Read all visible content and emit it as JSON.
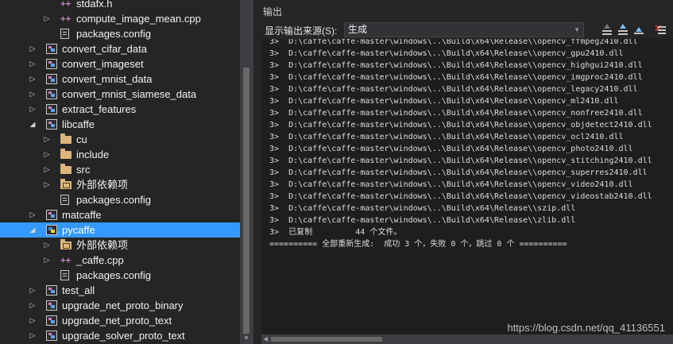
{
  "solution_explorer": {
    "items": [
      {
        "label": "stdafx.h",
        "icon": "header-file-icon",
        "arrow": "",
        "selected": false
      },
      {
        "label": "compute_image_mean.cpp",
        "icon": "cpp-file-icon",
        "arrow": "collapsed",
        "selected": false
      },
      {
        "label": "packages.config",
        "icon": "config-file-icon",
        "arrow": "",
        "selected": false
      },
      {
        "label": "convert_cifar_data",
        "icon": "project-icon",
        "arrow": "collapsed",
        "selected": false
      },
      {
        "label": "convert_imageset",
        "icon": "project-icon",
        "arrow": "collapsed",
        "selected": false
      },
      {
        "label": "convert_mnist_data",
        "icon": "project-icon",
        "arrow": "collapsed",
        "selected": false
      },
      {
        "label": "convert_mnist_siamese_data",
        "icon": "project-icon",
        "arrow": "collapsed",
        "selected": false
      },
      {
        "label": "extract_features",
        "icon": "project-icon",
        "arrow": "collapsed",
        "selected": false
      },
      {
        "label": "libcaffe",
        "icon": "project-icon",
        "arrow": "expanded",
        "selected": false
      },
      {
        "label": "cu",
        "icon": "folder-icon",
        "arrow": "collapsed",
        "selected": false
      },
      {
        "label": "include",
        "icon": "folder-icon",
        "arrow": "collapsed",
        "selected": false
      },
      {
        "label": "src",
        "icon": "folder-icon",
        "arrow": "collapsed",
        "selected": false
      },
      {
        "label": "外部依赖项",
        "icon": "external-deps-icon",
        "arrow": "collapsed",
        "selected": false
      },
      {
        "label": "packages.config",
        "icon": "config-file-icon",
        "arrow": "",
        "selected": false
      },
      {
        "label": "matcaffe",
        "icon": "project-icon",
        "arrow": "collapsed",
        "selected": false
      },
      {
        "label": "pycaffe",
        "icon": "python-project-icon",
        "arrow": "expanded",
        "selected": true
      },
      {
        "label": "外部依赖项",
        "icon": "external-deps-icon",
        "arrow": "collapsed",
        "selected": false
      },
      {
        "label": "_caffe.cpp",
        "icon": "cpp-file-icon",
        "arrow": "collapsed",
        "selected": false
      },
      {
        "label": "packages.config",
        "icon": "config-file-icon",
        "arrow": "",
        "selected": false
      },
      {
        "label": "test_all",
        "icon": "project-icon",
        "arrow": "collapsed",
        "selected": false
      },
      {
        "label": "upgrade_net_proto_binary",
        "icon": "project-icon",
        "arrow": "collapsed",
        "selected": false
      },
      {
        "label": "upgrade_net_proto_text",
        "icon": "project-icon",
        "arrow": "collapsed",
        "selected": false
      },
      {
        "label": "upgrade_solver_proto_text",
        "icon": "project-icon",
        "arrow": "collapsed",
        "selected": false
      }
    ]
  },
  "output": {
    "title": "输出",
    "source_label": "显示输出来源(S):",
    "source_value": "生成",
    "lines": [
      "3>  D:\\caffe\\caffe-master\\windows\\..\\Build\\x64\\Release\\\\opencv_ffmpeg2410.dll",
      "3>  D:\\caffe\\caffe-master\\windows\\..\\Build\\x64\\Release\\\\opencv_gpu2410.dll",
      "3>  D:\\caffe\\caffe-master\\windows\\..\\Build\\x64\\Release\\\\opencv_highgui2410.dll",
      "3>  D:\\caffe\\caffe-master\\windows\\..\\Build\\x64\\Release\\\\opencv_imgproc2410.dll",
      "3>  D:\\caffe\\caffe-master\\windows\\..\\Build\\x64\\Release\\\\opencv_legacy2410.dll",
      "3>  D:\\caffe\\caffe-master\\windows\\..\\Build\\x64\\Release\\\\opencv_ml2410.dll",
      "3>  D:\\caffe\\caffe-master\\windows\\..\\Build\\x64\\Release\\\\opencv_nonfree2410.dll",
      "3>  D:\\caffe\\caffe-master\\windows\\..\\Build\\x64\\Release\\\\opencv_objdetect2410.dll",
      "3>  D:\\caffe\\caffe-master\\windows\\..\\Build\\x64\\Release\\\\opencv_ocl2410.dll",
      "3>  D:\\caffe\\caffe-master\\windows\\..\\Build\\x64\\Release\\\\opencv_photo2410.dll",
      "3>  D:\\caffe\\caffe-master\\windows\\..\\Build\\x64\\Release\\\\opencv_stitching2410.dll",
      "3>  D:\\caffe\\caffe-master\\windows\\..\\Build\\x64\\Release\\\\opencv_superres2410.dll",
      "3>  D:\\caffe\\caffe-master\\windows\\..\\Build\\x64\\Release\\\\opencv_video2410.dll",
      "3>  D:\\caffe\\caffe-master\\windows\\..\\Build\\x64\\Release\\\\opencv_videostab2410.dll",
      "3>  D:\\caffe\\caffe-master\\windows\\..\\Build\\x64\\Release\\\\szip.dll",
      "3>  D:\\caffe\\caffe-master\\windows\\..\\Build\\x64\\Release\\\\zlib.dll",
      "3>  已复制         44 个文件。",
      "========== 全部重新生成:  成功 3 个，失败 0 个，跳过 0 个 =========="
    ]
  },
  "watermark": "https://blog.csdn.net/qq_41136551"
}
